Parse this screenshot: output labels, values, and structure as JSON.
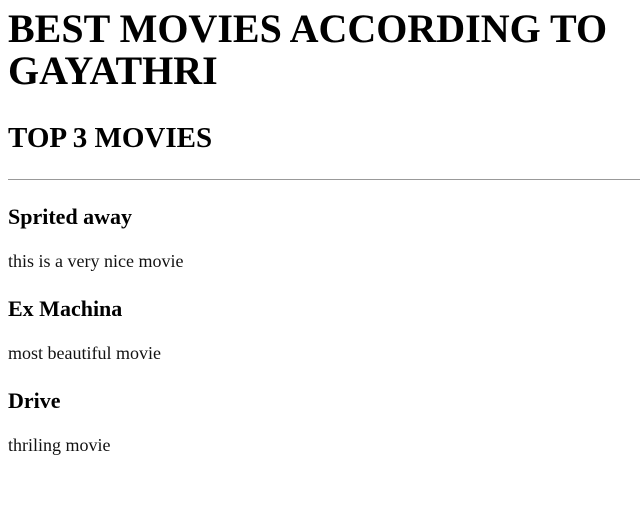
{
  "page": {
    "title": "BEST MOVIES ACCORDING TO GAYATHRI",
    "subtitle": "TOP 3 MOVIES"
  },
  "movies": [
    {
      "name": "Sprited away",
      "description": "this is a very nice movie"
    },
    {
      "name": "Ex Machina",
      "description": "most beautiful movie"
    },
    {
      "name": "Drive",
      "description": "thriling movie"
    }
  ]
}
